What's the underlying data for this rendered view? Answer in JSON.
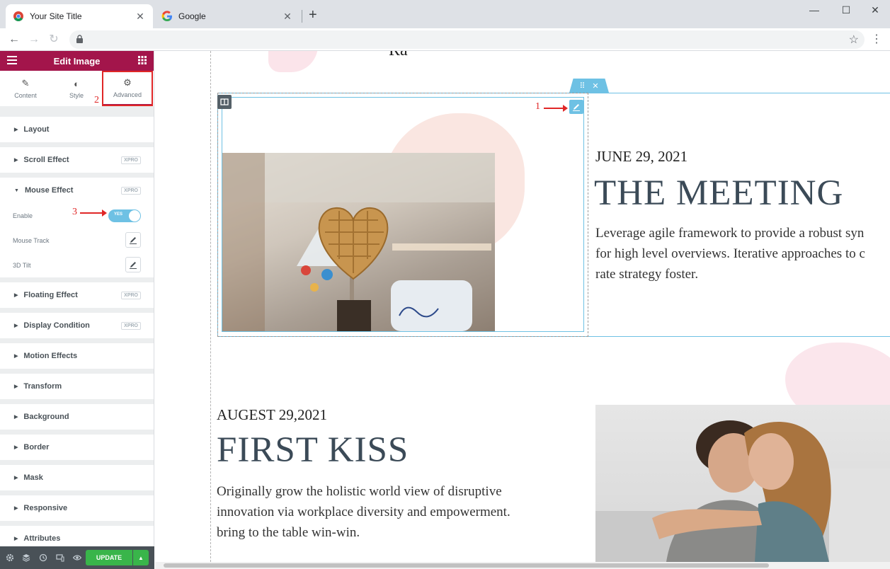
{
  "browser": {
    "tabs": [
      {
        "label": "Your Site Title",
        "active": true
      },
      {
        "label": "Google",
        "active": false
      }
    ],
    "new_tab": "+",
    "close_glyph": "✕",
    "window_controls": [
      "—",
      "☐",
      "✕"
    ],
    "nav": {
      "back": "←",
      "forward": "→",
      "reload": "↻"
    },
    "star": "☆",
    "menu": "⋮"
  },
  "panel": {
    "title": "Edit Image",
    "tabs": [
      {
        "label": "Content",
        "icon": "pencil-icon",
        "glyph": "✎"
      },
      {
        "label": "Style",
        "icon": "contrast-icon",
        "glyph": "◐"
      },
      {
        "label": "Advanced",
        "icon": "gear-icon",
        "glyph": "⚙"
      }
    ],
    "pro_badge": "XPRO",
    "sections_before": [
      {
        "label": "Layout",
        "pro": false
      },
      {
        "label": "Scroll Effect",
        "pro": true
      }
    ],
    "mouse_effect": {
      "label": "Mouse Effect",
      "enable_label": "Enable",
      "toggle_text": "YES",
      "enabled": true,
      "mouse_track_label": "Mouse Track",
      "tilt_label": "3D Tilt"
    },
    "sections_after": [
      {
        "label": "Floating Effect",
        "pro": true
      },
      {
        "label": "Display Condition",
        "pro": true
      },
      {
        "label": "Motion Effects",
        "pro": false
      },
      {
        "label": "Transform",
        "pro": false
      },
      {
        "label": "Background",
        "pro": false
      },
      {
        "label": "Border",
        "pro": false
      },
      {
        "label": "Mask",
        "pro": false
      },
      {
        "label": "Responsive",
        "pro": false
      },
      {
        "label": "Attributes",
        "pro": false
      }
    ],
    "update_label": "UPDATE",
    "collapse_glyph": "‹",
    "colors": {
      "header": "#a3154b",
      "update": "#39b54a",
      "accent": "#6ec1e4"
    }
  },
  "canvas": {
    "top_partial_text": "Ra",
    "post1": {
      "date": "JUNE 29, 2021",
      "title": "THE MEETING",
      "lines": [
        "Leverage agile framework to provide a robust syn",
        "for high level overviews. Iterative approaches to c",
        "rate strategy foster."
      ]
    },
    "post2": {
      "date": "AUGEST 29,2021",
      "title": "FIRST KISS",
      "lines": [
        "Originally grow the holistic world view of disruptive",
        "innovation via workplace diversity and empowerment.",
        "bring to the table win-win."
      ]
    },
    "section_handle": {
      "move": "⠿",
      "close": "✕"
    }
  },
  "annotations": {
    "n1": "1",
    "n2": "2",
    "n3": "3"
  }
}
